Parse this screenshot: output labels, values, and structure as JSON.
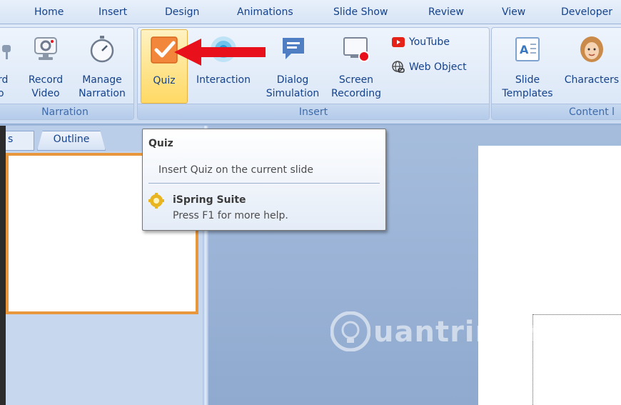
{
  "menu": {
    "tabs": [
      "Home",
      "Insert",
      "Design",
      "Animations",
      "Slide Show",
      "Review",
      "View",
      "Developer"
    ]
  },
  "ribbon": {
    "narration": {
      "label": "Narration",
      "partial_button_line1": "rd",
      "partial_button_line2": "o",
      "record_video_line1": "Record",
      "record_video_line2": "Video",
      "manage_narration_line1": "Manage",
      "manage_narration_line2": "Narration"
    },
    "insert": {
      "label": "Insert",
      "quiz": "Quiz",
      "interaction": "Interaction",
      "dialog_line1": "Dialog",
      "dialog_line2": "Simulation",
      "screen_line1": "Screen",
      "screen_line2": "Recording",
      "youtube": "YouTube",
      "web_object": "Web Object"
    },
    "content": {
      "label": "Content l",
      "slide_templates_line1": "Slide",
      "slide_templates_line2": "Templates",
      "characters": "Characters"
    }
  },
  "panes": {
    "slides_tab": "s",
    "outline_tab": "Outline"
  },
  "tooltip": {
    "title": "Quiz",
    "description": "Insert Quiz on the current slide",
    "brand": "iSpring Suite",
    "help": "Press F1 for more help."
  },
  "watermark": {
    "text": "uantrimang"
  },
  "colors": {
    "accent_orange": "#e9973c",
    "ribbon_text": "#15428b",
    "arrow_red": "#e8101a"
  }
}
